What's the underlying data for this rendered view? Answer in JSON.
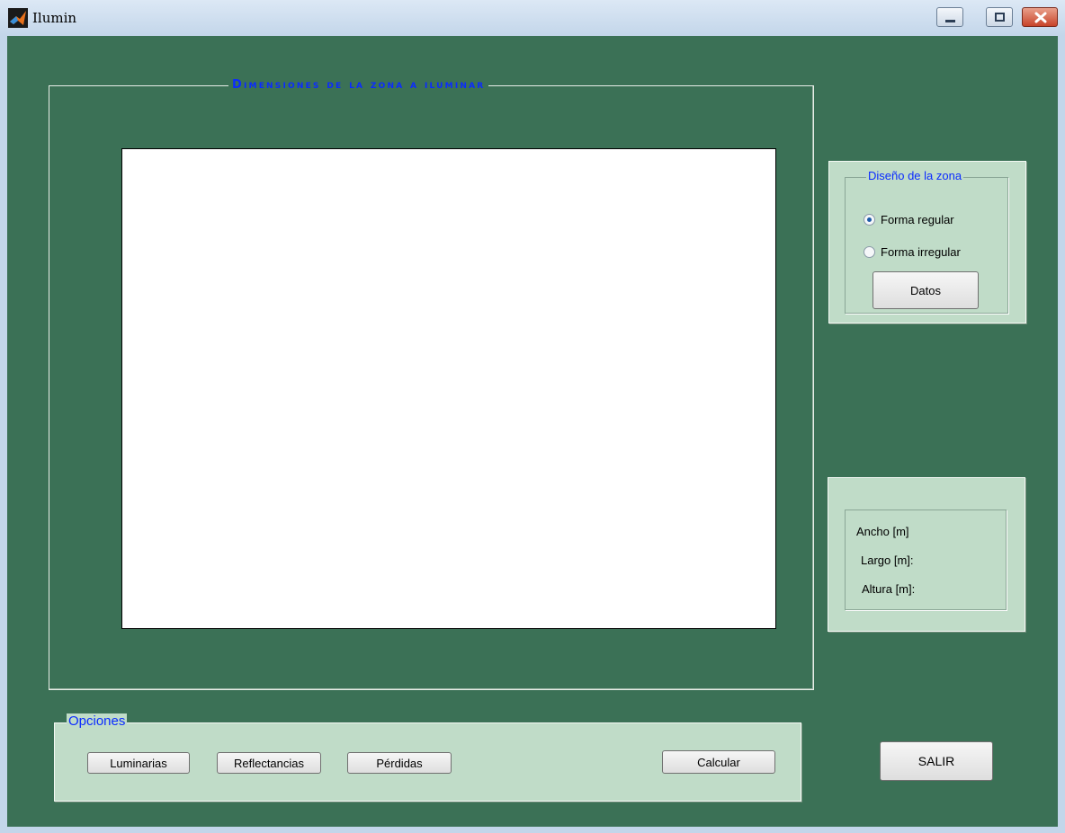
{
  "window": {
    "title": "Ilumin"
  },
  "main_panel": {
    "title": "Dimensiones de la zona a iluminar"
  },
  "design_panel": {
    "title": "Diseño de la zona",
    "radio_regular": {
      "label": "Forma regular",
      "selected": true
    },
    "radio_irregular": {
      "label": "Forma irregular",
      "selected": false
    },
    "datos_button": "Datos"
  },
  "dims_panel": {
    "ancho": "Ancho [m]",
    "largo": "Largo [m]:",
    "altura": "Altura [m]:"
  },
  "options": {
    "title": "Opciones",
    "luminarias": "Luminarias",
    "reflectancias": "Reflectancias",
    "perdidas": "Pérdidas",
    "calcular": "Calcular"
  },
  "salir_button": "SALIR",
  "colors": {
    "background": "#3b7156",
    "panel": "#c0dcc8",
    "accent_title": "#0b2bff"
  }
}
